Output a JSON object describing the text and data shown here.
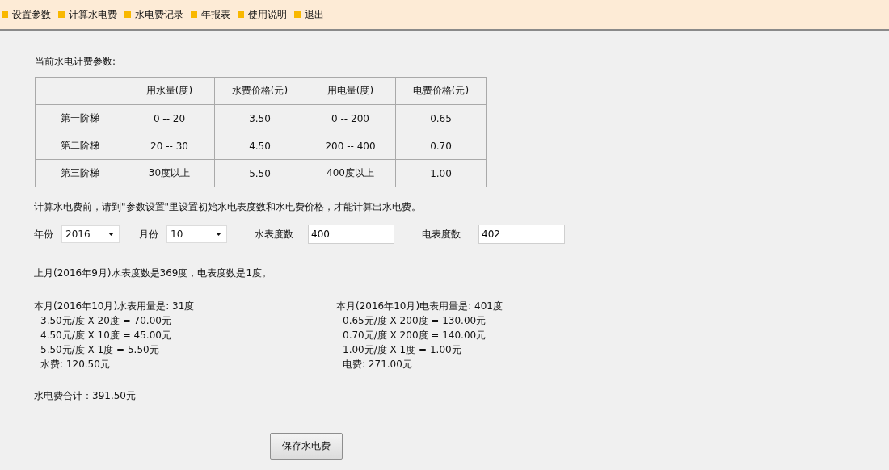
{
  "menu": [
    {
      "label": "设置参数"
    },
    {
      "label": "计算水电费"
    },
    {
      "label": "水电费记录"
    },
    {
      "label": "年报表"
    },
    {
      "label": "使用说明"
    },
    {
      "label": "退出"
    }
  ],
  "params_title": "当前水电计费参数:",
  "table": {
    "columns": [
      "用水量(度)",
      "水费价格(元)",
      "用电量(度)",
      "电费价格(元)"
    ],
    "rows": [
      {
        "tier": "第一阶梯",
        "cells": [
          "0 -- 20",
          "3.50",
          "0 -- 200",
          "0.65"
        ]
      },
      {
        "tier": "第二阶梯",
        "cells": [
          "20 -- 30",
          "4.50",
          "200 -- 400",
          "0.70"
        ]
      },
      {
        "tier": "第三阶梯",
        "cells": [
          "30度以上",
          "5.50",
          "400度以上",
          "1.00"
        ]
      }
    ]
  },
  "notice": "计算水电费前，请到\"参数设置\"里设置初始水电表度数和水电费价格，才能计算出水电费。",
  "form": [
    {
      "kind": "dropdown",
      "label": "年份",
      "value": "2016"
    },
    {
      "kind": "dropdown",
      "label": "月份",
      "value": "10"
    },
    {
      "kind": "input",
      "label": "水表度数",
      "value": "400"
    },
    {
      "kind": "input",
      "label": "电表度数",
      "value": "402"
    }
  ],
  "last_month": "上月(2016年9月)水表度数是369度，电表度数是1度。",
  "water": {
    "heading": "本月(2016年10月)水表用量是: 31度",
    "lines": [
      "3.50元/度 X 20度 = 70.00元",
      "4.50元/度 X 10度 = 45.00元",
      "5.50元/度 X 1度 = 5.50元"
    ],
    "total": "水费: 120.50元"
  },
  "power": {
    "heading": "本月(2016年10月)电表用量是: 401度",
    "lines": [
      "0.65元/度 X 200度 = 130.00元",
      "0.70元/度 X 200度 = 140.00元",
      "1.00元/度 X 1度 = 1.00元"
    ],
    "total": "电费: 271.00元"
  },
  "grand_total": "水电费合计：391.50元",
  "save_button": "保存水电费"
}
